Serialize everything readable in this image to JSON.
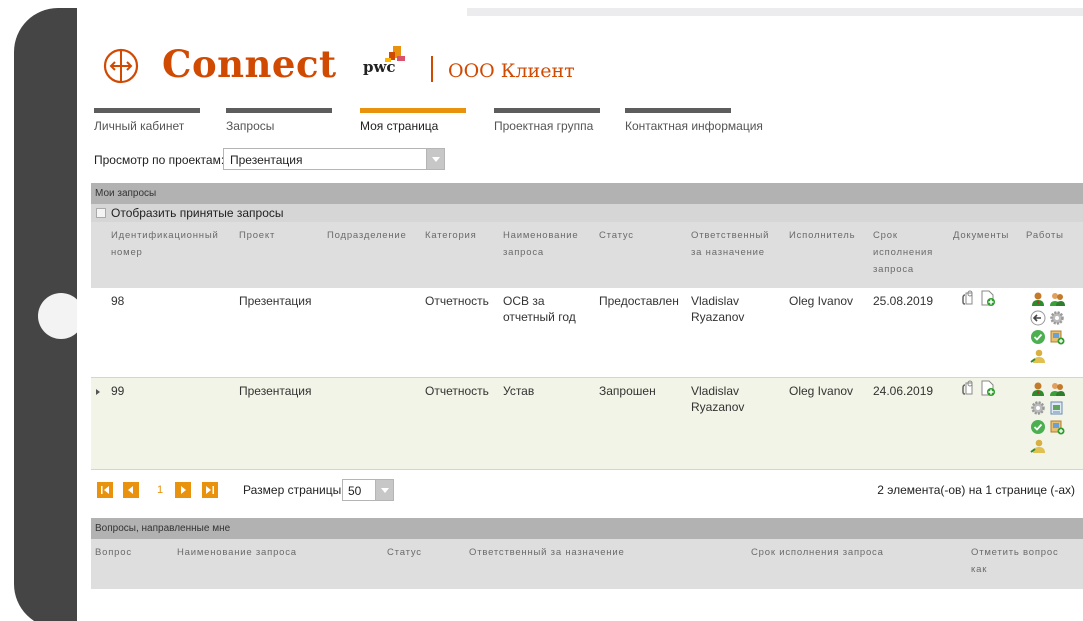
{
  "brand": {
    "app_name": "Connect",
    "pwc": "pwc",
    "client": "ООО Клиент",
    "accent": "#d04a02",
    "nav_active_color": "#e8920d"
  },
  "nav": {
    "items": [
      {
        "label": "Личный кабинет"
      },
      {
        "label": "Запросы"
      },
      {
        "label": "Моя страница",
        "active": true
      },
      {
        "label": "Проектная группа"
      },
      {
        "label": "Контактная информация"
      }
    ]
  },
  "filter": {
    "label": "Просмотр по проектам:",
    "value": "Презентация"
  },
  "my_requests": {
    "title": "Мои запросы",
    "toggle_label": "Отобразить принятые запросы",
    "columns": {
      "id": [
        "Идентификационный",
        "номер"
      ],
      "project": [
        "Проект"
      ],
      "division": [
        "Подразделение"
      ],
      "category": [
        "Категория"
      ],
      "name": [
        "Наименование",
        "запроса"
      ],
      "status": [
        "Статус"
      ],
      "responsible": [
        "Ответственный",
        "за назначение"
      ],
      "executor": [
        "Исполнитель"
      ],
      "deadline": [
        "Срок",
        "исполнения",
        "запроса"
      ],
      "documents": [
        "Документы"
      ],
      "works": [
        "Работы"
      ]
    },
    "rows": [
      {
        "id": "98",
        "project": "Презентация",
        "category": "Отчетность",
        "name": [
          "ОСВ за",
          "отчетный год"
        ],
        "status": "Предоставлен",
        "responsible": [
          "Vladislav",
          "Ryazanov"
        ],
        "executor": "Oleg Ivanov",
        "deadline": "25.08.2019",
        "work_icons": [
          "assign-users-icon",
          "return-icon",
          "settings-icon",
          "accept-icon",
          "add-document-icon",
          "reassign-icon"
        ]
      },
      {
        "id": "99",
        "project": "Презентация",
        "category": "Отчетность",
        "name": [
          "Устав"
        ],
        "status": "Запрошен",
        "responsible": [
          "Vladislav",
          "Ryazanov"
        ],
        "executor": "Oleg Ivanov",
        "deadline": "24.06.2019",
        "work_icons": [
          "assign-users-icon",
          "settings-icon",
          "document-view-icon",
          "accept-icon",
          "add-document-icon",
          "reassign-icon"
        ]
      }
    ],
    "selected_row_color": "#f1f4e6"
  },
  "pager": {
    "current_page": "1",
    "page_size_label": "Размер страницы:",
    "page_size": "50",
    "summary": "2 элемента(-ов) на 1 странице (-ах)"
  },
  "questions": {
    "title": "Вопросы, направленные мне",
    "columns": {
      "question": "Вопрос",
      "name": "Наименование запроса",
      "status": "Статус",
      "responsible": "Ответственный за назначение",
      "deadline": "Срок исполнения запроса",
      "mark": [
        "Отметить вопрос",
        "как"
      ]
    }
  }
}
